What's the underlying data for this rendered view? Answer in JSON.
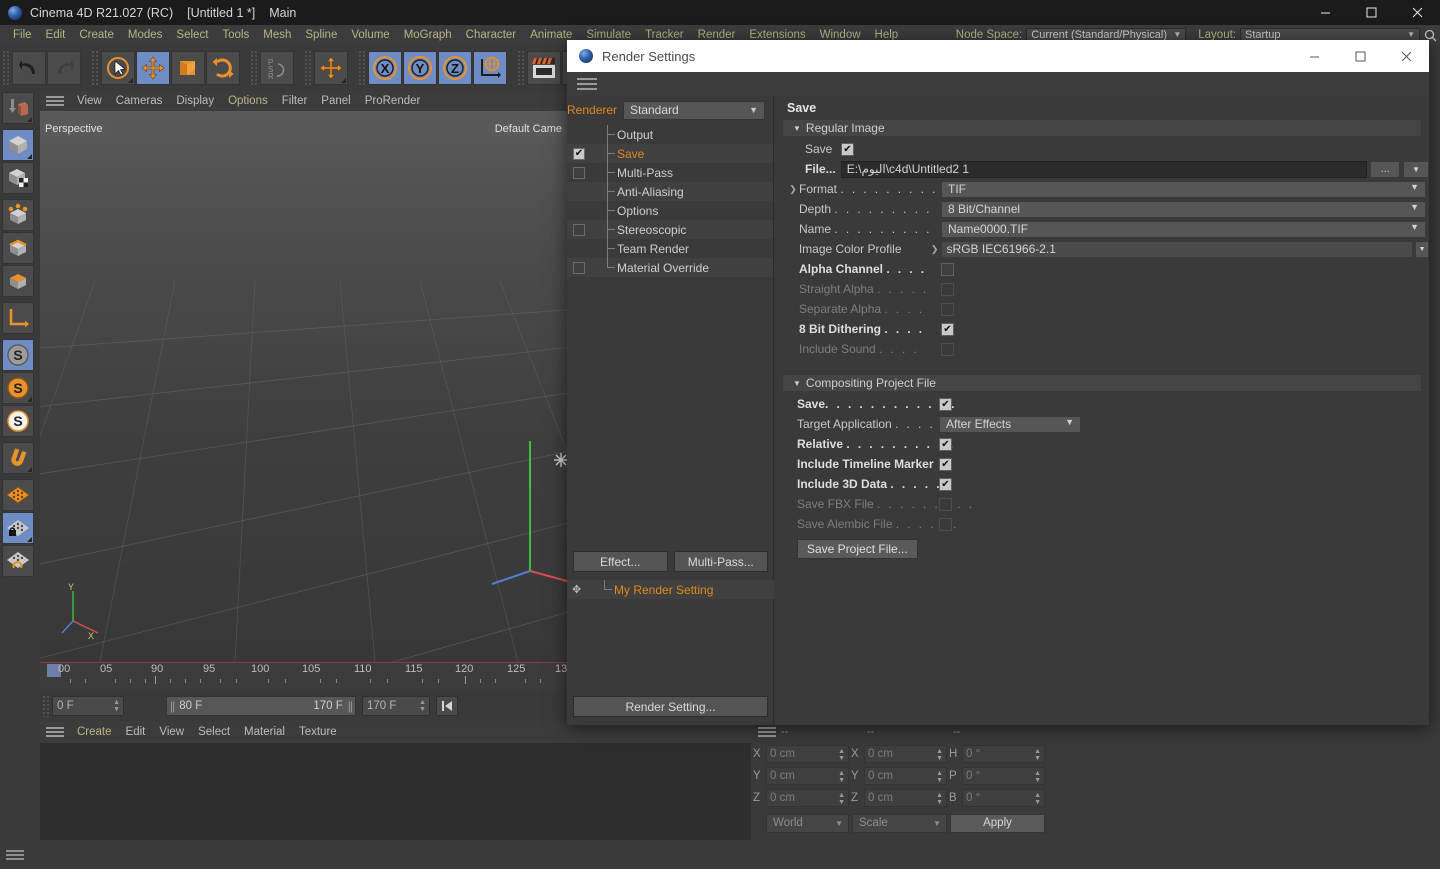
{
  "app": {
    "title": "Cinema 4D R21.027 (RC)",
    "document": "[Untitled 1 *]",
    "layout_name": "Main",
    "logo_icon": "c4d-logo-icon",
    "window_controls": {
      "minimize": "minimize-icon",
      "maximize": "maximize-icon",
      "close": "close-icon"
    }
  },
  "menubar": {
    "items": [
      "File",
      "Edit",
      "Create",
      "Modes",
      "Select",
      "Tools",
      "Mesh",
      "Spline",
      "Volume",
      "MoGraph",
      "Character",
      "Animate",
      "Simulate",
      "Tracker",
      "Render",
      "Extensions",
      "Window",
      "Help"
    ],
    "node_space_label": "Node Space:",
    "node_space_value": "Current (Standard/Physical)",
    "layout_label": "Layout:",
    "layout_value": "Startup",
    "search_icon": "search-icon"
  },
  "toolbar": {
    "groups": [
      {
        "buttons": [
          {
            "name": "undo-button",
            "icon": "undo-arrow-icon",
            "selected": false
          },
          {
            "name": "redo-button",
            "icon": "redo-arrow-icon",
            "selected": false
          }
        ]
      },
      {
        "buttons": [
          {
            "name": "live-selection-tool",
            "icon": "cursor-circle-icon",
            "selected": false
          },
          {
            "name": "move-tool",
            "icon": "move-arrows-icon",
            "selected": true
          },
          {
            "name": "scale-tool",
            "icon": "scale-box-icon",
            "selected": false
          },
          {
            "name": "rotate-tool",
            "icon": "rotate-arc-icon",
            "selected": false
          }
        ]
      },
      {
        "buttons": [
          {
            "name": "psr-tool",
            "icon": "psr-icon",
            "selected": false
          }
        ]
      },
      {
        "buttons": [
          {
            "name": "move-axis-tool",
            "icon": "move-arrows-icon",
            "selected": false
          }
        ]
      },
      {
        "buttons": [
          {
            "name": "x-axis-lock-button",
            "icon": "x-axis-icon",
            "selected": true
          },
          {
            "name": "y-axis-lock-button",
            "icon": "y-axis-icon",
            "selected": true
          },
          {
            "name": "z-axis-lock-button",
            "icon": "z-axis-icon",
            "selected": true
          },
          {
            "name": "world-coordinates-button",
            "icon": "globe-axis-icon",
            "selected": true
          }
        ]
      },
      {
        "buttons": [
          {
            "name": "render-view-button",
            "icon": "clapper-frame-icon",
            "selected": false
          },
          {
            "name": "render-to-picture-viewer-button",
            "icon": "clapper-play-icon",
            "selected": false
          },
          {
            "name": "render-settings-button",
            "icon": "clapper-gear-icon",
            "selected": false
          }
        ]
      }
    ]
  },
  "left_palette": {
    "groups": [
      [
        {
          "name": "make-editable-button",
          "icon": "make-editable-icon",
          "selected": false
        }
      ],
      [
        {
          "name": "model-mode-button",
          "icon": "model-cube-icon",
          "selected": true
        },
        {
          "name": "texture-mode-button",
          "icon": "texture-cube-icon",
          "selected": false
        }
      ],
      [
        {
          "name": "points-mode-button",
          "icon": "points-cube-icon",
          "selected": false
        },
        {
          "name": "edges-mode-button",
          "icon": "edges-cube-icon",
          "selected": false
        },
        {
          "name": "polygons-mode-button",
          "icon": "polygons-cube-icon",
          "selected": false
        }
      ],
      [
        {
          "name": "axis-mode-button",
          "icon": "axis-corner-icon",
          "selected": false
        }
      ],
      [
        {
          "name": "enable-axis-modification-button",
          "icon": "s-gray-icon",
          "selected": true
        },
        {
          "name": "object-axis-button",
          "icon": "s-orange-icon",
          "selected": false
        },
        {
          "name": "world-axis-button",
          "icon": "s-white-icon",
          "selected": false
        }
      ],
      [
        {
          "name": "magnet-tool-button",
          "icon": "magnet-icon",
          "selected": false
        }
      ],
      [
        {
          "name": "workplane-button",
          "icon": "grid-plane-icon",
          "selected": false
        },
        {
          "name": "lock-workplane-button",
          "icon": "grid-lock-icon",
          "selected": true
        },
        {
          "name": "workplane-rotate-button",
          "icon": "grid-rotate-icon",
          "selected": false
        }
      ]
    ]
  },
  "viewport": {
    "menu": [
      "View",
      "Cameras",
      "Display",
      "Options",
      "Filter",
      "Panel",
      "ProRender"
    ],
    "highlight_item": "Options",
    "burger_icon": "hamburger-icon",
    "label_left": "Perspective",
    "label_right": "Default Came",
    "light_icon": "light-gizmo-icon",
    "axis_labels": {
      "y": "Y",
      "x": "X"
    }
  },
  "timeline": {
    "tick_labels": [
      "00",
      "05",
      "90",
      "95",
      "100",
      "105",
      "110",
      "115",
      "120",
      "125",
      "13"
    ],
    "current_frame": "0 F",
    "range_start": "80 F",
    "range_end": "170 F",
    "max_frame": "170 F",
    "handle_icon": "range-handle-icon",
    "goto-start-icon": "goto-start-icon"
  },
  "material_manager": {
    "menu": [
      "Create",
      "Edit",
      "View",
      "Select",
      "Material",
      "Texture"
    ],
    "highlight_item": "Create",
    "burger_icon": "hamburger-icon"
  },
  "coordinates": {
    "burger_icon": "hamburger-icon",
    "headers": [
      "--",
      "--",
      "--"
    ],
    "rows": [
      {
        "axis1": "X",
        "v1": "0 cm",
        "axis2": "X",
        "v2": "0 cm",
        "axis3": "H",
        "v3": "0 °"
      },
      {
        "axis1": "Y",
        "v1": "0 cm",
        "axis2": "Y",
        "v2": "0 cm",
        "axis3": "P",
        "v3": "0 °"
      },
      {
        "axis1": "Z",
        "v1": "0 cm",
        "axis2": "Z",
        "v2": "0 cm",
        "axis3": "B",
        "v3": "0 °"
      }
    ],
    "coordinate_system": "World",
    "mode": "Scale",
    "apply_label": "Apply"
  },
  "render_settings": {
    "window_title": "Render Settings",
    "logo_icon": "c4d-logo-icon",
    "window_controls": {
      "minimize": "minimize-icon",
      "maximize": "maximize-icon",
      "close": "close-icon"
    },
    "burger_icon": "hamburger-icon",
    "renderer_label": "Renderer",
    "renderer_value": "Standard",
    "tree": [
      {
        "label": "Output",
        "checkbox": "none",
        "checked": false,
        "selected": false
      },
      {
        "label": "Save",
        "checkbox": "yes",
        "checked": true,
        "selected": true
      },
      {
        "label": "Multi-Pass",
        "checkbox": "yes",
        "checked": false,
        "selected": false
      },
      {
        "label": "Anti-Aliasing",
        "checkbox": "none",
        "checked": false,
        "selected": false
      },
      {
        "label": "Options",
        "checkbox": "none",
        "checked": false,
        "selected": false
      },
      {
        "label": "Stereoscopic",
        "checkbox": "yes",
        "checked": false,
        "selected": false
      },
      {
        "label": "Team Render",
        "checkbox": "none",
        "checked": false,
        "selected": false
      },
      {
        "label": "Material Override",
        "checkbox": "yes",
        "checked": false,
        "selected": false
      }
    ],
    "effect_button": "Effect...",
    "multipass_button": "Multi-Pass...",
    "my_render_setting": "My Render Setting",
    "render_setting_button": "Render Setting...",
    "page_title": "Save",
    "regular_image": {
      "group_title": "Regular Image",
      "save_label": "Save",
      "save_checked": true,
      "file_label": "File...",
      "file_value": "E:\\اليوم\\c4d\\Untitled2 1",
      "file_browse_button": "...",
      "format_label": "Format",
      "format_dots": ". . . . . . . . .",
      "format_value": "TIF",
      "depth_label": "Depth",
      "depth_dots": ". . . . . . . . .",
      "depth_value": "8 Bit/Channel",
      "name_label": "Name",
      "name_dots": ". . . . . . . . .",
      "name_value": "Name0000.TIF",
      "color_profile_label": "Image Color Profile",
      "color_profile_value": "sRGB IEC61966-2.1",
      "alpha_channel_label": "Alpha Channel",
      "alpha_channel_dots": ". . . .",
      "alpha_channel_checked": false,
      "straight_alpha_label": "Straight Alpha",
      "straight_alpha_dots": ". . . . .",
      "straight_alpha_checked": false,
      "separate_alpha_label": "Separate Alpha",
      "separate_alpha_dots": ". . . .",
      "separate_alpha_checked": false,
      "dithering_label": "8 Bit Dithering",
      "dithering_dots": ". . . .",
      "dithering_checked": true,
      "include_sound_label": "Include Sound",
      "include_sound_dots": ". . . .",
      "include_sound_checked": false
    },
    "compositing": {
      "group_title": "Compositing Project File",
      "save_label": "Save",
      "save_dots": ". . . . . . . . . . . .",
      "save_checked": true,
      "target_app_label": "Target Application",
      "target_app_dots": ". . . . .",
      "target_app_value": "After Effects",
      "relative_label": "Relative",
      "relative_dots": ". . . . . . . . . .",
      "relative_checked": true,
      "timeline_marker_label": "Include Timeline Marker",
      "timeline_marker_checked": true,
      "include_3d_label": "Include 3D Data",
      "include_3d_dots": ". . . . . .",
      "include_3d_checked": true,
      "save_fbx_label": "Save FBX File",
      "save_fbx_dots": ". . . . . . . . .",
      "save_fbx_checked": false,
      "save_alembic_label": "Save Alembic File",
      "save_alembic_dots": ". . . . . .",
      "save_alembic_checked": false,
      "save_project_button": "Save Project File..."
    }
  },
  "colors": {
    "accent_orange": "#e08a1e",
    "menu_yellow": "#b9b487",
    "selection_blue": "#6f8cc4",
    "panel_bg": "#3a3a3a",
    "titlebar_bg": "#1b1b1b"
  }
}
